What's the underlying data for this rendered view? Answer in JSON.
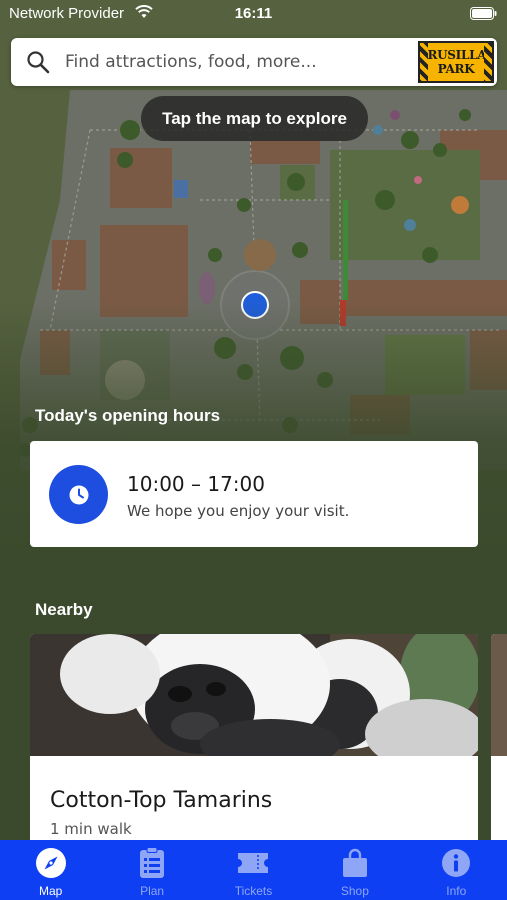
{
  "status_bar": {
    "carrier": "Network Provider",
    "time": "16:11"
  },
  "search": {
    "placeholder": "Find attractions, food, more...",
    "logo_line1": "DRUSILLAS",
    "logo_line2": "PARK"
  },
  "map": {
    "hint": "Tap the map to explore"
  },
  "hours": {
    "title": "Today's opening hours",
    "time": "10:00 – 17:00",
    "message": "We hope you enjoy your visit."
  },
  "nearby": {
    "title": "Nearby",
    "items": [
      {
        "name": "Cotton-Top Tamarins",
        "distance": "1 min walk"
      }
    ]
  },
  "tabs": [
    {
      "label": "Map",
      "icon": "compass-icon",
      "active": true
    },
    {
      "label": "Plan",
      "icon": "checklist-icon",
      "active": false
    },
    {
      "label": "Tickets",
      "icon": "ticket-icon",
      "active": false
    },
    {
      "label": "Shop",
      "icon": "shopping-bag-icon",
      "active": false
    },
    {
      "label": "Info",
      "icon": "info-icon",
      "active": false
    }
  ],
  "colors": {
    "accent_blue": "#0f3ff2",
    "clock_badge": "#1d4ee0",
    "background": "#3b4a2c"
  }
}
